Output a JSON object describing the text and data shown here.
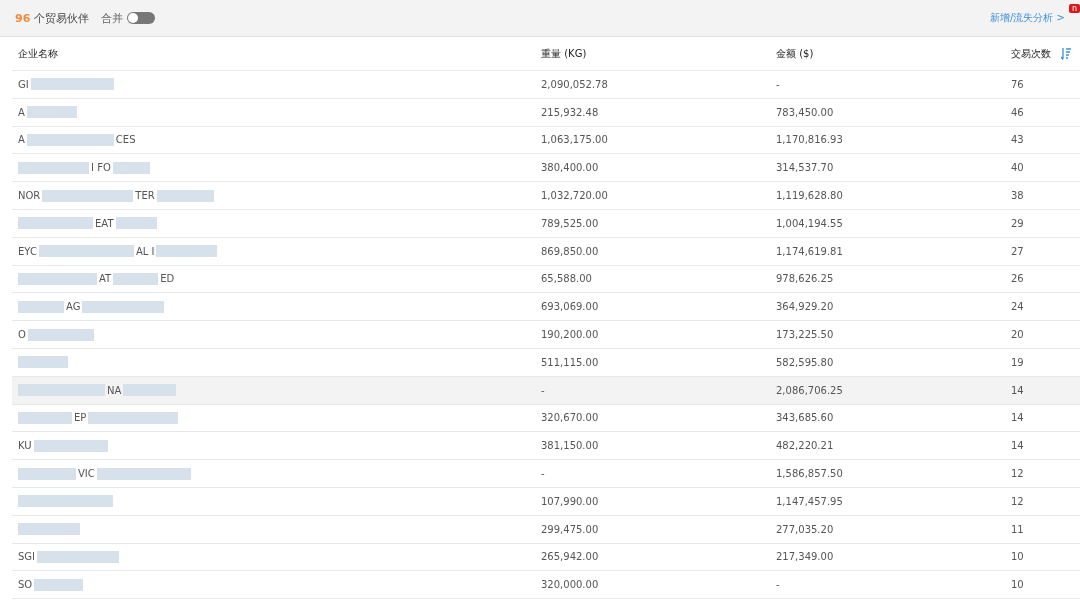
{
  "summary": {
    "count": "96",
    "label": "个贸易伙伴",
    "merge_label": "合并",
    "merge_on": false
  },
  "analysis_link": "新增/流失分析 >",
  "badge": "n",
  "table": {
    "columns": [
      "企业名称",
      "重量 (KG)",
      "金额 ($)",
      "交易次数"
    ],
    "rows": [
      {
        "name_parts": [
          {
            "kind": "text",
            "text": "GI"
          },
          {
            "kind": "blur"
          }
        ],
        "weight": "2,090,052.78",
        "amount": "-",
        "count": "76",
        "highlighted": false
      },
      {
        "name_parts": [
          {
            "kind": "text",
            "text": "A"
          },
          {
            "kind": "blur"
          }
        ],
        "weight": "215,932.48",
        "amount": "783,450.00",
        "count": "46",
        "highlighted": false
      },
      {
        "name_parts": [
          {
            "kind": "text",
            "text": "A"
          },
          {
            "kind": "blur"
          },
          {
            "kind": "text",
            "text": "CES"
          }
        ],
        "weight": "1,063,175.00",
        "amount": "1,170,816.93",
        "count": "43",
        "highlighted": false
      },
      {
        "name_parts": [
          {
            "kind": "blur"
          },
          {
            "kind": "text",
            "text": "I FO"
          },
          {
            "kind": "blur"
          }
        ],
        "weight": "380,400.00",
        "amount": "314,537.70",
        "count": "40",
        "highlighted": false
      },
      {
        "name_parts": [
          {
            "kind": "text",
            "text": "NOR"
          },
          {
            "kind": "blur"
          },
          {
            "kind": "text",
            "text": "TER"
          },
          {
            "kind": "blur"
          }
        ],
        "weight": "1,032,720.00",
        "amount": "1,119,628.80",
        "count": "38",
        "highlighted": false
      },
      {
        "name_parts": [
          {
            "kind": "blur"
          },
          {
            "kind": "text",
            "text": "EAT"
          },
          {
            "kind": "blur"
          }
        ],
        "weight": "789,525.00",
        "amount": "1,004,194.55",
        "count": "29",
        "highlighted": false
      },
      {
        "name_parts": [
          {
            "kind": "text",
            "text": "EYC"
          },
          {
            "kind": "blur"
          },
          {
            "kind": "text",
            "text": "AL I"
          },
          {
            "kind": "blur"
          }
        ],
        "weight": "869,850.00",
        "amount": "1,174,619.81",
        "count": "27",
        "highlighted": false
      },
      {
        "name_parts": [
          {
            "kind": "blur"
          },
          {
            "kind": "text",
            "text": "AT"
          },
          {
            "kind": "blur"
          },
          {
            "kind": "text",
            "text": "ED"
          }
        ],
        "weight": "65,588.00",
        "amount": "978,626.25",
        "count": "26",
        "highlighted": false
      },
      {
        "name_parts": [
          {
            "kind": "blur"
          },
          {
            "kind": "text",
            "text": "AG"
          },
          {
            "kind": "blur"
          }
        ],
        "weight": "693,069.00",
        "amount": "364,929.20",
        "count": "24",
        "highlighted": false
      },
      {
        "name_parts": [
          {
            "kind": "text",
            "text": "O"
          },
          {
            "kind": "blur"
          }
        ],
        "weight": "190,200.00",
        "amount": "173,225.50",
        "count": "20",
        "highlighted": false
      },
      {
        "name_parts": [
          {
            "kind": "blur"
          }
        ],
        "weight": "511,115.00",
        "amount": "582,595.80",
        "count": "19",
        "highlighted": false
      },
      {
        "name_parts": [
          {
            "kind": "blur"
          },
          {
            "kind": "text",
            "text": "NA"
          },
          {
            "kind": "blur"
          }
        ],
        "weight": "-",
        "amount": "2,086,706.25",
        "count": "14",
        "highlighted": true
      },
      {
        "name_parts": [
          {
            "kind": "blur"
          },
          {
            "kind": "text",
            "text": "EP"
          },
          {
            "kind": "blur"
          }
        ],
        "weight": "320,670.00",
        "amount": "343,685.60",
        "count": "14",
        "highlighted": false
      },
      {
        "name_parts": [
          {
            "kind": "text",
            "text": "KU"
          },
          {
            "kind": "blur"
          }
        ],
        "weight": "381,150.00",
        "amount": "482,220.21",
        "count": "14",
        "highlighted": false
      },
      {
        "name_parts": [
          {
            "kind": "blur"
          },
          {
            "kind": "text",
            "text": "VIC"
          },
          {
            "kind": "blur"
          }
        ],
        "weight": "-",
        "amount": "1,586,857.50",
        "count": "12",
        "highlighted": false
      },
      {
        "name_parts": [
          {
            "kind": "blur"
          }
        ],
        "weight": "107,990.00",
        "amount": "1,147,457.95",
        "count": "12",
        "highlighted": false
      },
      {
        "name_parts": [
          {
            "kind": "blur"
          }
        ],
        "weight": "299,475.00",
        "amount": "277,035.20",
        "count": "11",
        "highlighted": false
      },
      {
        "name_parts": [
          {
            "kind": "text",
            "text": "SGI"
          },
          {
            "kind": "blur"
          }
        ],
        "weight": "265,942.00",
        "amount": "217,349.00",
        "count": "10",
        "highlighted": false
      },
      {
        "name_parts": [
          {
            "kind": "text",
            "text": "SO"
          },
          {
            "kind": "blur"
          }
        ],
        "weight": "320,000.00",
        "amount": "-",
        "count": "10",
        "highlighted": false
      }
    ]
  }
}
